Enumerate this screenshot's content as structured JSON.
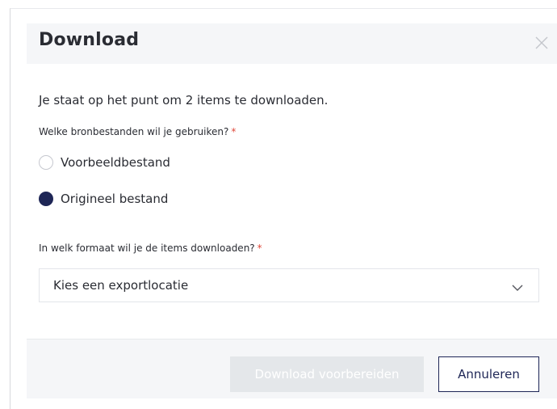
{
  "dialog": {
    "title": "Download",
    "intro": "Je staat op het punt om 2 items te downloaden.",
    "close_icon": "close-icon"
  },
  "source_question": {
    "label": "Welke bronbestanden wil je gebruiken?",
    "required_marker": "*",
    "options": [
      {
        "label": "Voorbeeldbestand",
        "selected": false
      },
      {
        "label": "Origineel bestand",
        "selected": true
      }
    ]
  },
  "format_question": {
    "label": "In welk formaat wil je de items downloaden?",
    "required_marker": "*",
    "select_value": "Kies een exportlocatie",
    "select_icon": "chevron-down-icon"
  },
  "footer": {
    "primary_label": "Download voorbereiden",
    "primary_disabled": true,
    "secondary_label": "Annuleren"
  },
  "colors": {
    "accent": "#1e2656",
    "required": "#e0493b",
    "disabled_button": "#e4e7ea",
    "panel_bg": "#f5f6f8"
  }
}
